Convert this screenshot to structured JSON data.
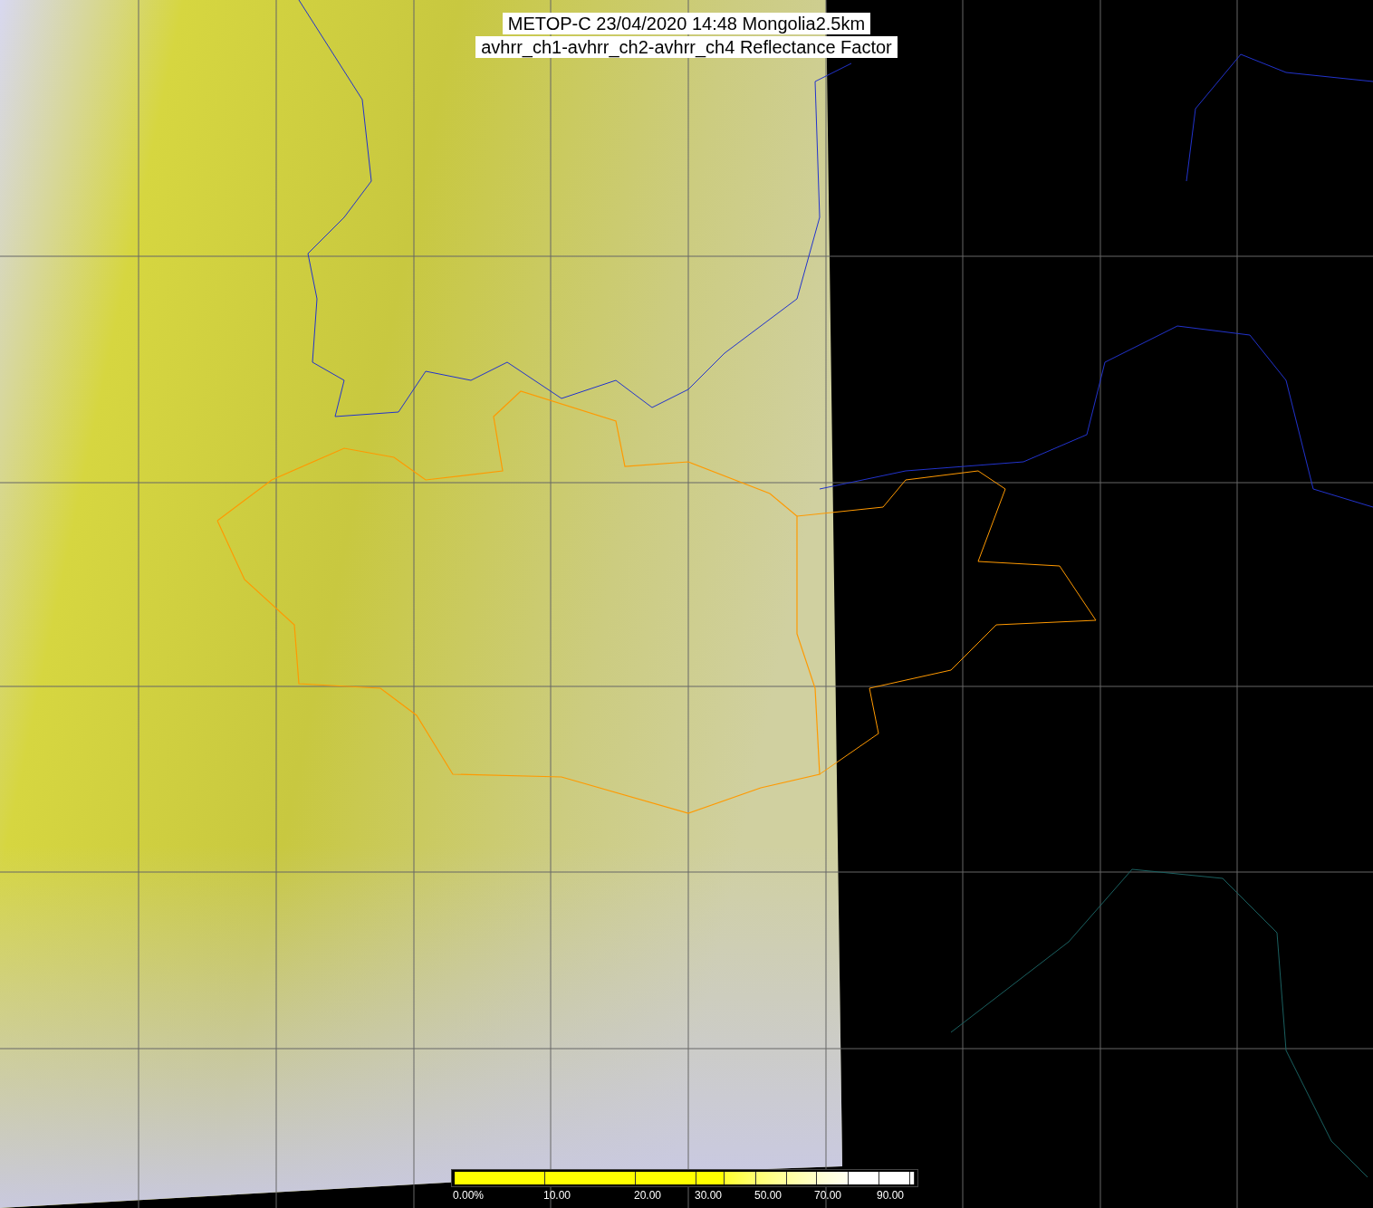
{
  "title": {
    "lines": [
      "METOP-C 23/04/2020 14:48 Mongolia2.5km",
      "avhrr_ch1-avhrr_ch2-avhrr_ch4 Reflectance Factor"
    ]
  },
  "colorbar": {
    "labels": [
      "0.00%",
      "10.00",
      "20.00",
      "30.00",
      "50.00",
      "70.00",
      "90.00"
    ]
  }
}
